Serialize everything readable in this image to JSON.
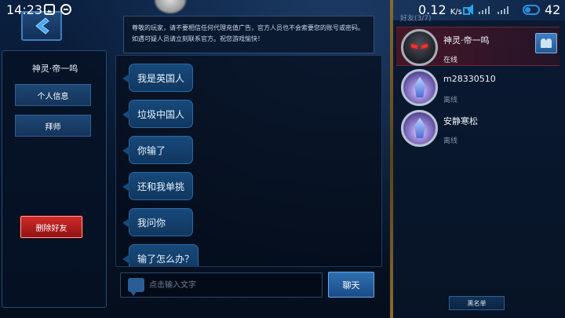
{
  "status_bar": {
    "time": "14:23",
    "net_speed": "0.12",
    "net_speed_unit": "K/s",
    "battery": "42"
  },
  "profile": {
    "name": "神灵·帝一鸣",
    "info_label": "个人信息",
    "master_label": "拜师",
    "delete_label": "删除好友"
  },
  "chat": {
    "notice": "尊敬的玩家，请不要相信任何代理充值广告，官方人员也不会索要您的账号或密码。如遇可疑人员请立刻联系官方。祝您游戏愉快！",
    "messages": [
      "我是英国人",
      "垃圾中国人",
      "你输了",
      "还和我单挑",
      "我问你",
      "输了怎么办？"
    ],
    "input_placeholder": "点击输入文字",
    "send_label": "聊天"
  },
  "friends": {
    "header": "好友(3/7)",
    "items": [
      {
        "name": "神灵·帝一鸣",
        "status": "在线"
      },
      {
        "name": "m28330510",
        "status": "离线"
      },
      {
        "name": "安静寒松",
        "status": "离线"
      }
    ],
    "blacklist_label": "黑名单"
  },
  "colors": {
    "background": "#06101e",
    "panel_border": "#274a72",
    "bubble": "#17497a",
    "delete_red": "#d32a2a",
    "divider_gold": "#8b6a2e",
    "accent_blue": "#22a6e8"
  },
  "icons": [
    "gallery-icon",
    "circle-app-icon",
    "volume-icon",
    "signal-icon",
    "toggle-icon",
    "back-arrow-icon",
    "chat-bubble-icon",
    "team-icon"
  ]
}
